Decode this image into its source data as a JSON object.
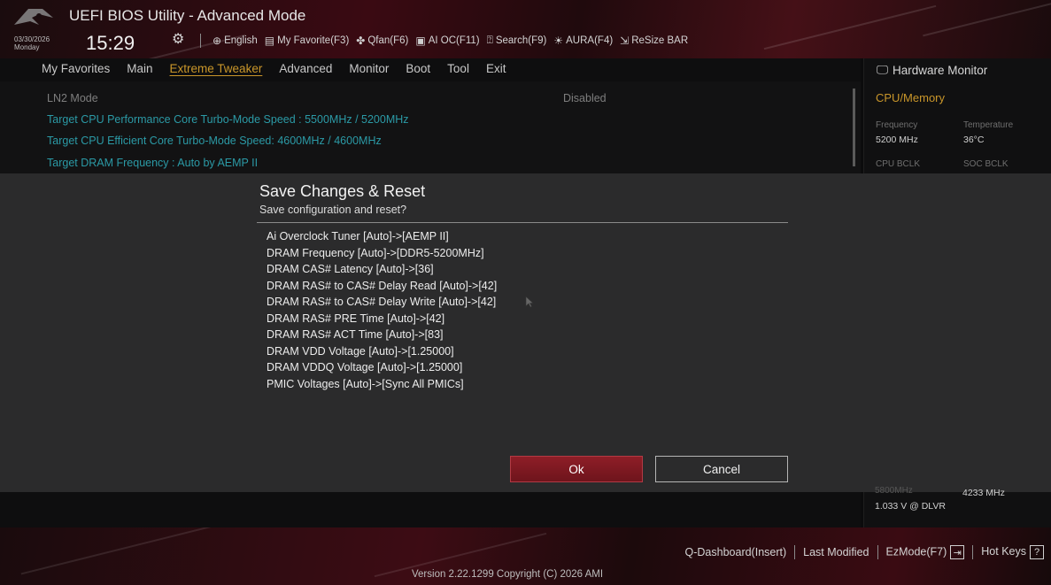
{
  "header": {
    "title": "UEFI BIOS Utility - Advanced Mode",
    "date": "03/30/2026",
    "weekday": "Monday",
    "time": "15:29",
    "toolbar": [
      {
        "icon": "globe-icon",
        "label": "English"
      },
      {
        "icon": "favorite-icon",
        "label": "My Favorite(F3)"
      },
      {
        "icon": "fan-icon",
        "label": "Qfan(F6)"
      },
      {
        "icon": "ai-oc-icon",
        "label": "AI OC(F11)"
      },
      {
        "icon": "search-icon",
        "label": "Search(F9)"
      },
      {
        "icon": "aura-icon",
        "label": "AURA(F4)"
      },
      {
        "icon": "resize-bar-icon",
        "label": "ReSize BAR"
      }
    ]
  },
  "menu": {
    "items": [
      "My Favorites",
      "Main",
      "Extreme Tweaker",
      "Advanced",
      "Monitor",
      "Boot",
      "Tool",
      "Exit"
    ],
    "active": "Extreme Tweaker"
  },
  "content": {
    "ln2_label": "LN2 Mode",
    "ln2_value": "Disabled",
    "perf_core": "Target CPU Performance Core Turbo-Mode Speed : 5500MHz / 5200MHz",
    "eff_core": "Target CPU Efficient Core Turbo-Mode Speed: 4600MHz / 4600MHz",
    "dram_freq": "Target DRAM Frequency : Auto by AEMP II"
  },
  "hw_monitor": {
    "title": "Hardware Monitor",
    "section": "CPU/Memory",
    "frequency_label": "Frequency",
    "frequency_value": "5200 MHz",
    "temperature_label": "Temperature",
    "temperature_value": "36°C",
    "cpu_bclk_label": "CPU BCLK",
    "soc_bclk_label": "SOC BCLK",
    "partial_top": "5800MHz",
    "partial_right": "4233 MHz",
    "voltage": "1.033 V @ DLVR"
  },
  "dialog": {
    "title": "Save Changes & Reset",
    "subtitle": "Save configuration and reset?",
    "changes": [
      "Ai Overclock Tuner [Auto]->[AEMP II]",
      "DRAM Frequency [Auto]->[DDR5-5200MHz]",
      "DRAM CAS# Latency [Auto]->[36]",
      "DRAM RAS# to CAS# Delay Read [Auto]->[42]",
      "DRAM RAS# to CAS# Delay Write [Auto]->[42]",
      "DRAM RAS# PRE Time [Auto]->[42]",
      "DRAM RAS# ACT Time [Auto]->[83]",
      "DRAM VDD Voltage [Auto]->[1.25000]",
      "DRAM VDDQ Voltage [Auto]->[1.25000]",
      "PMIC Voltages [Auto]->[Sync All PMICs]"
    ],
    "ok_label": "Ok",
    "cancel_label": "Cancel"
  },
  "footer": {
    "q_dashboard": "Q-Dashboard(Insert)",
    "last_modified": "Last Modified",
    "ezmode": "EzMode(F7)",
    "hotkeys": "Hot Keys",
    "hotkeys_glyph": "?",
    "version": "Version 2.22.1299 Copyright (C) 2026 AMI"
  },
  "colors": {
    "accent_gold": "#c9962a",
    "accent_teal": "#2b9aa6",
    "ok_red": "#8e1e27"
  }
}
